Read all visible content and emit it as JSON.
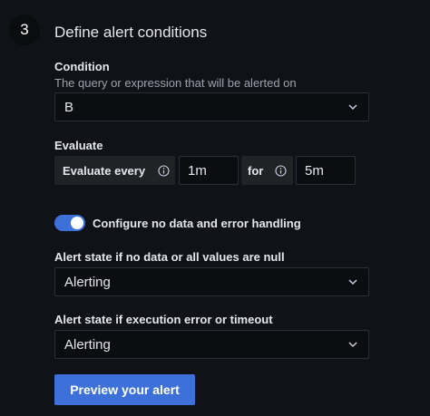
{
  "step": {
    "number": "3",
    "title": "Define alert conditions"
  },
  "condition": {
    "label": "Condition",
    "description": "The query or expression that will be alerted on",
    "selected": "B",
    "chevron_icon": "chevron-down-icon"
  },
  "evaluate": {
    "label": "Evaluate",
    "every_label": "Evaluate every",
    "every_value": "1m",
    "for_label": "for",
    "for_value": "5m",
    "info_icon": "info-circle-icon"
  },
  "no_data_toggle": {
    "enabled": true,
    "label": "Configure no data and error handling"
  },
  "no_data_state": {
    "label": "Alert state if no data or all values are null",
    "selected": "Alerting"
  },
  "error_state": {
    "label": "Alert state if execution error or timeout",
    "selected": "Alerting"
  },
  "preview_button": {
    "label": "Preview your alert"
  },
  "colors": {
    "background": "#111217",
    "accent": "#3d71d9",
    "input_background": "#0c0d11",
    "addon_background": "#202226"
  }
}
